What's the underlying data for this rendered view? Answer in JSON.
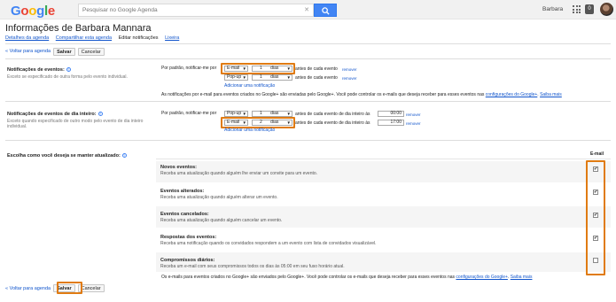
{
  "header": {
    "logo_letters": [
      "G",
      "o",
      "o",
      "g",
      "l",
      "e"
    ],
    "search_placeholder": "Pesquisar no Google Agenda",
    "search_clear": "✕",
    "user_name": "Barbara",
    "notifications_count": "0"
  },
  "page": {
    "title": "Informações de Barbara Mannara",
    "tabs": [
      {
        "label": "Detalhes da agenda",
        "active": false
      },
      {
        "label": "Compartilhar esta agenda",
        "active": false
      },
      {
        "label": "Editar notificações",
        "active": true
      },
      {
        "label": "Lixeira",
        "active": false
      }
    ]
  },
  "actions": {
    "back_label": "« Voltar para agenda",
    "save_label": "Salvar",
    "cancel_label": "Cancelar"
  },
  "event_notifications": {
    "label": "Notificações de eventos:",
    "sublabel": "Exceto se especificado de outra forma pelo evento individual.",
    "default_label": "Por padrão, notificar-me por",
    "rows": [
      {
        "method": "E-mail",
        "amount": "1",
        "unit": "dias",
        "suffix": "antes de cada evento",
        "remove": "remover"
      },
      {
        "method": "Pop-up",
        "amount": "1",
        "unit": "dias",
        "suffix": "antes de cada evento",
        "remove": "remover"
      }
    ],
    "add_link": "Adicionar uma notificação",
    "footnote": "As notificações por e-mail para eventos criados no Google+ são enviadas pelo Google+. Você pode controlar os e-mails que deseja receber para esses eventos nas",
    "footnote_link1": "configurações do Google+",
    "footnote_link2": "Saiba mais"
  },
  "allday_notifications": {
    "label": "Notificações de eventos de dia inteiro:",
    "sublabel": "Exceto quando especificado de outro modo pelo evento de dia inteiro individual.",
    "default_label": "Por padrão, notificar-me por",
    "rows": [
      {
        "method": "Pop-up",
        "amount": "1",
        "unit": "dias",
        "suffix": "antes de cada evento de dia inteiro às",
        "time": "00:00",
        "remove": "remover"
      },
      {
        "method": "E-mail",
        "amount": "2",
        "unit": "dias",
        "suffix": "antes de cada evento de dia inteiro às",
        "time": "17:00",
        "remove": "remover"
      }
    ],
    "add_link": "Adicionar uma notificação"
  },
  "updates": {
    "label": "Escolha como você deseja se manter atualizado:",
    "column_header": "E-mail",
    "items": [
      {
        "title": "Novos eventos:",
        "desc": "Receba uma atualização quando alguém lhe enviar um convite para um evento.",
        "checked": true
      },
      {
        "title": "Eventos alterados:",
        "desc": "Receba uma atualização quando alguém alterar um evento.",
        "checked": true
      },
      {
        "title": "Eventos cancelados:",
        "desc": "Receba uma atualização quando alguém cancelar um evento.",
        "checked": true
      },
      {
        "title": "Respostas dos eventos:",
        "desc": "Receba uma notificação quando os convidados respondem a um evento com lista de convidados visualizável.",
        "checked": true
      },
      {
        "title": "Compromissos diários:",
        "desc": "Receba um e-mail com seus compromissos todos os dias às 05:00 em seu fuso horário atual.",
        "checked": false
      }
    ],
    "footnote": "Os e-mails para eventos criados no Google+ são enviados pelo Google+. Você pode controlar os e-mails que deseja receber para esses eventos nas",
    "footnote_link1": "configurações do Google+",
    "footnote_link2": "Saiba mais"
  },
  "colors": {
    "highlight": "#e07b12",
    "link": "#1155cc",
    "search_button": "#4285f4"
  }
}
